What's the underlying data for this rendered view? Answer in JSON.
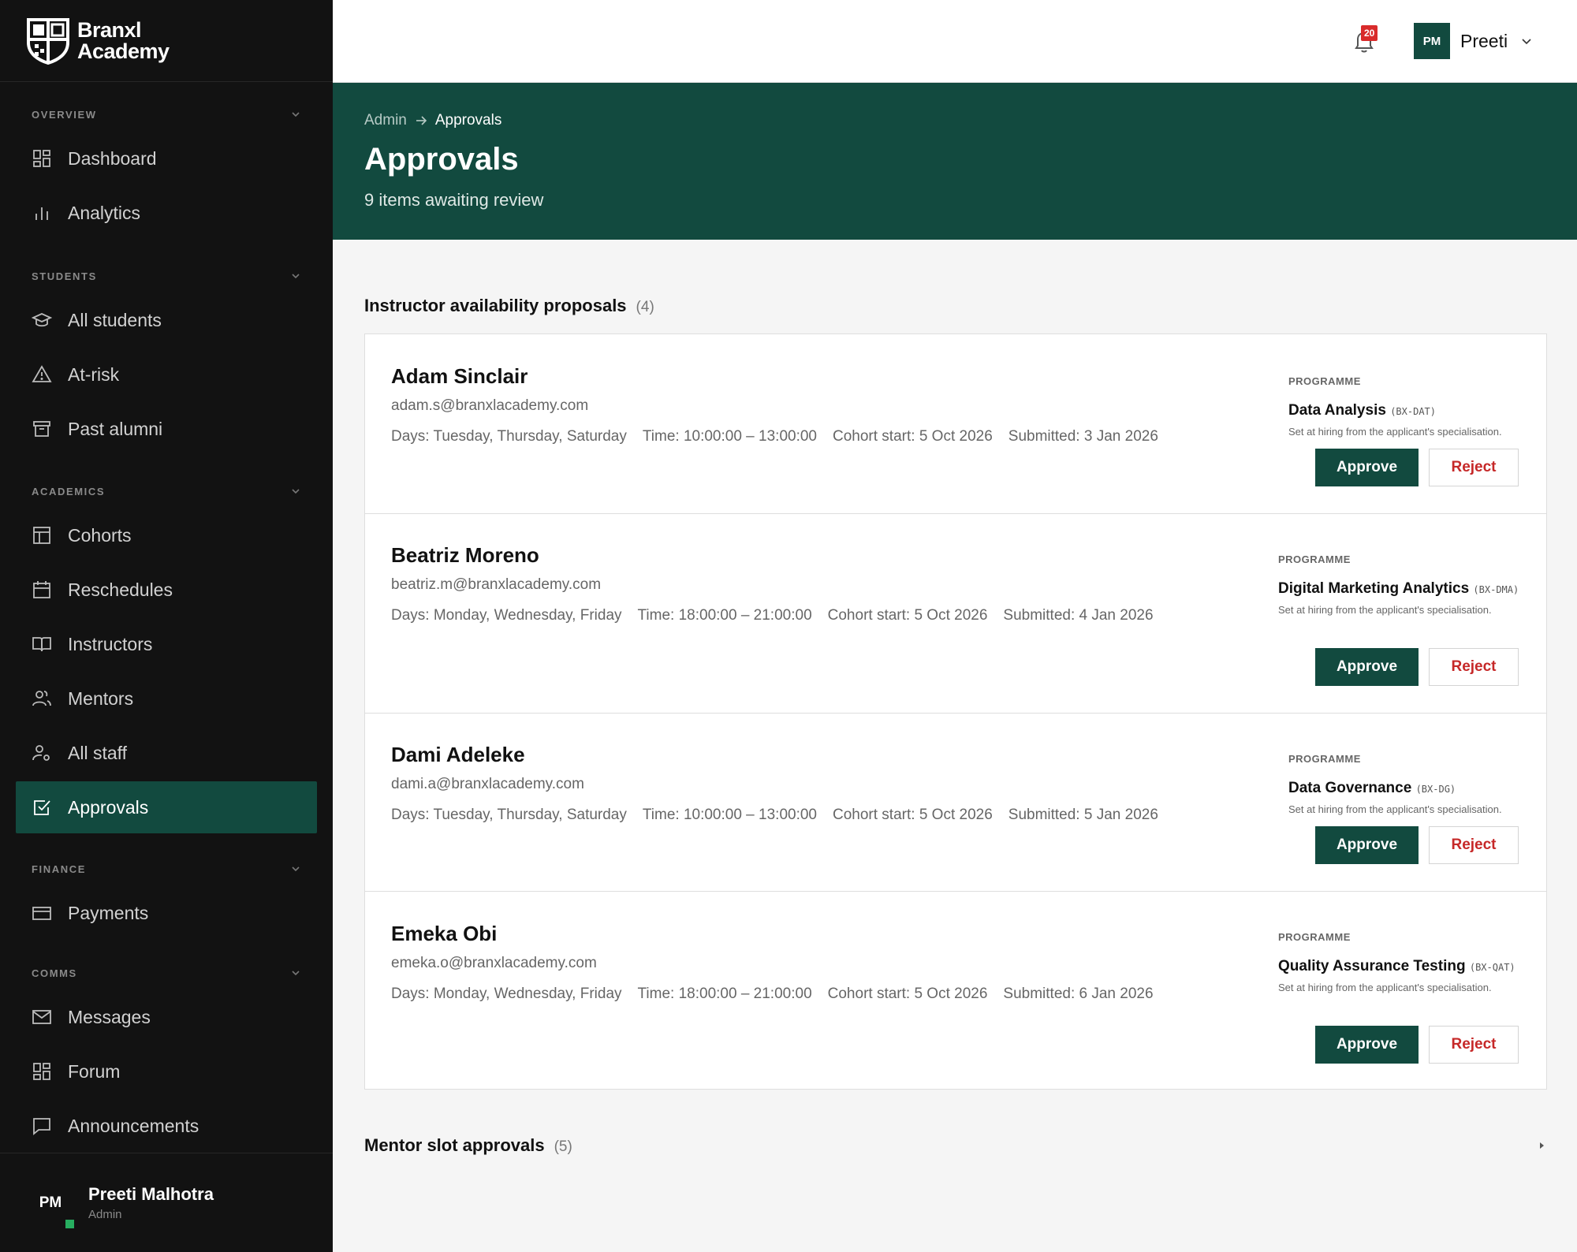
{
  "brand": {
    "line1": "Branxl",
    "line2": "Academy"
  },
  "sidebar": {
    "sections": [
      {
        "label": "OVERVIEW",
        "items": [
          {
            "label": "Dashboard",
            "icon": "dashboard-icon"
          },
          {
            "label": "Analytics",
            "icon": "analytics-icon"
          }
        ]
      },
      {
        "label": "STUDENTS",
        "items": [
          {
            "label": "All students",
            "icon": "graduation-cap-icon"
          },
          {
            "label": "At-risk",
            "icon": "warning-icon"
          },
          {
            "label": "Past alumni",
            "icon": "archive-icon"
          }
        ]
      },
      {
        "label": "ACADEMICS",
        "items": [
          {
            "label": "Cohorts",
            "icon": "layout-icon"
          },
          {
            "label": "Reschedules",
            "icon": "calendar-icon"
          },
          {
            "label": "Instructors",
            "icon": "book-icon"
          },
          {
            "label": "Mentors",
            "icon": "users-icon"
          },
          {
            "label": "All staff",
            "icon": "user-cog-icon"
          },
          {
            "label": "Approvals",
            "icon": "check-square-icon",
            "active": true
          }
        ]
      },
      {
        "label": "FINANCE",
        "items": [
          {
            "label": "Payments",
            "icon": "card-icon"
          }
        ]
      },
      {
        "label": "COMMS",
        "items": [
          {
            "label": "Messages",
            "icon": "mail-icon"
          },
          {
            "label": "Forum",
            "icon": "forum-icon"
          },
          {
            "label": "Announcements",
            "icon": "chat-icon"
          }
        ]
      }
    ],
    "user": {
      "initials": "PM",
      "name": "Preeti Malhotra",
      "role": "Admin"
    }
  },
  "topbar": {
    "notifications": "20",
    "user_initials": "PM",
    "user_name": "Preeti"
  },
  "header": {
    "crumb_parent": "Admin",
    "crumb_current": "Approvals",
    "title": "Approvals",
    "subtitle": "9 items awaiting review"
  },
  "instructor_section": {
    "title": "Instructor availability proposals",
    "count": "(4)"
  },
  "programme_label": "PROGRAMME",
  "programme_hint": "Set at hiring from the applicant's specialisation.",
  "approve_label": "Approve",
  "reject_label": "Reject",
  "proposals": [
    {
      "name": "Adam Sinclair",
      "email": "adam.s@branxlacademy.com",
      "days": "Days: Tuesday, Thursday, Saturday",
      "time": "Time: 10:00:00 – 13:00:00",
      "cohort": "Cohort start: 5 Oct 2026",
      "submitted": "Submitted: 3 Jan 2026",
      "programme": "Data Analysis",
      "code": "(BX-DAT)"
    },
    {
      "name": "Beatriz Moreno",
      "email": "beatriz.m@branxlacademy.com",
      "days": "Days: Monday, Wednesday, Friday",
      "time": "Time: 18:00:00 – 21:00:00",
      "cohort": "Cohort start: 5 Oct 2026",
      "submitted": "Submitted: 4 Jan 2026",
      "programme": "Digital Marketing Analytics",
      "code": "(BX-DMA)"
    },
    {
      "name": "Dami Adeleke",
      "email": "dami.a@branxlacademy.com",
      "days": "Days: Tuesday, Thursday, Saturday",
      "time": "Time: 10:00:00 – 13:00:00",
      "cohort": "Cohort start: 5 Oct 2026",
      "submitted": "Submitted: 5 Jan 2026",
      "programme": "Data Governance",
      "code": "(BX-DG)"
    },
    {
      "name": "Emeka Obi",
      "email": "emeka.o@branxlacademy.com",
      "days": "Days: Monday, Wednesday, Friday",
      "time": "Time: 18:00:00 – 21:00:00",
      "cohort": "Cohort start: 5 Oct 2026",
      "submitted": "Submitted: 6 Jan 2026",
      "programme": "Quality Assurance Testing",
      "code": "(BX-QAT)"
    }
  ],
  "mentor_section": {
    "title": "Mentor slot approvals",
    "count": "(5)"
  }
}
